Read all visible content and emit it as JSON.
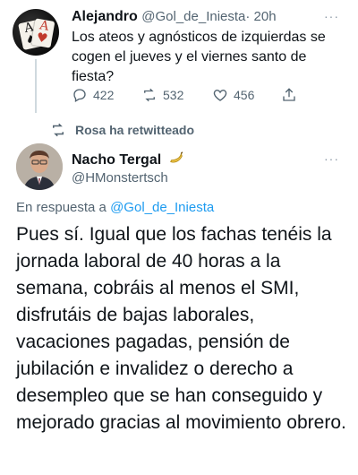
{
  "quoted_tweet": {
    "author_name": "Alejandro",
    "handle": "@Gol_de_Iniesta",
    "time": "· 20h",
    "more": "···",
    "text": "Los ateos y agnósticos de izquierdas se cogen el jueves y el viernes santo de fiesta?",
    "replies": "422",
    "retweets": "532",
    "likes": "456",
    "avatar_icon": "playing-cards-avatar"
  },
  "retweet_notice": {
    "text": "Rosa ha retwitteado",
    "icon": "retweet-icon"
  },
  "main_tweet": {
    "author_name": "Nacho Tergal",
    "badge_icon": "banana-emoji",
    "handle": "@HMonstertsch",
    "more": "···",
    "reply_prefix": "En respuesta a",
    "reply_to": "@Gol_de_Iniesta",
    "text": "Pues sí. Igual que los fachas tenéis la jornada laboral de 40 horas a la semana, cobráis al menos el SMI, disfrutáis de bajas laborales, vacaciones pagadas, pensión de jubilación e invalidez o derecho a desempleo que se han conseguido y mejorado gracias al movimiento obrero."
  },
  "colors": {
    "accent": "#1d9bf0",
    "secondary_text": "#536471",
    "thread_line": "#cfd9de"
  }
}
